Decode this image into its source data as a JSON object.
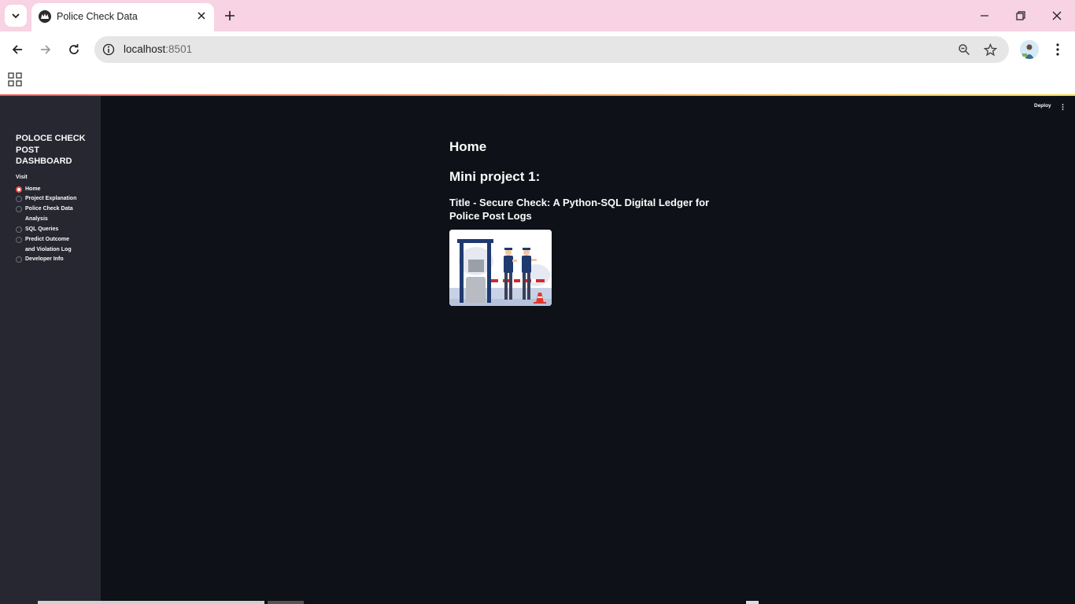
{
  "browser": {
    "tab_title": "Police Check Data",
    "url_host": "localhost",
    "url_port": ":8501"
  },
  "app": {
    "sidebar": {
      "title": "POLOCE CHECK POST DASHBOARD",
      "radio_label": "Visit",
      "options": [
        {
          "label": "Home",
          "checked": true
        },
        {
          "label": "Project Explanation",
          "checked": false
        },
        {
          "label": "Police Check Data Analysis",
          "checked": false
        },
        {
          "label": "SQL Queries",
          "checked": false
        },
        {
          "label": "Predict Outcome and Violation Log",
          "checked": false
        },
        {
          "label": "Developer Info",
          "checked": false
        }
      ]
    },
    "header": {
      "deploy_label": "Deploy"
    },
    "main": {
      "heading": "Home",
      "subheading": "Mini project 1:",
      "project_title": "Title - Secure Check: A Python-SQL Digital Ledger for Police Post Logs",
      "image_icon": "police-checkpoint-illustration"
    },
    "colors": {
      "accent": "#ff4b4b",
      "background": "#0e1117",
      "sidebar": "#262730",
      "tabbar": "#f7d3e3"
    }
  }
}
